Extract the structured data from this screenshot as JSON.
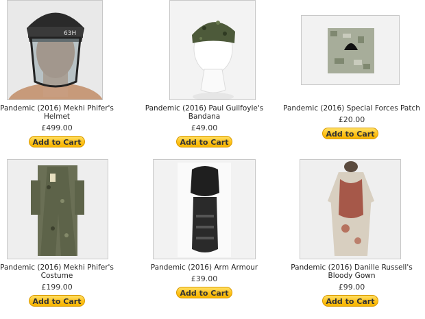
{
  "products": [
    {
      "title_line1": "Pandemic (2016) Mekhi Phifer's",
      "title_line2": "Helmet",
      "price": "£499.00",
      "button": "Add to Cart",
      "helmet_label": "63H"
    },
    {
      "title_line1": "Pandemic (2016) Paul Guilfoyle's",
      "title_line2": "Bandana",
      "price": "£49.00",
      "button": "Add to Cart"
    },
    {
      "title_line1": "Pandemic (2016) Special Forces Patch",
      "title_line2": "",
      "price": "£20.00",
      "button": "Add to Cart"
    },
    {
      "title_line1": "Pandemic (2016) Mekhi Phifer's",
      "title_line2": "Costume",
      "price": "£199.00",
      "button": "Add to Cart"
    },
    {
      "title_line1": "Pandemic (2016) Arm Armour",
      "title_line2": "",
      "price": "£39.00",
      "button": "Add to Cart"
    },
    {
      "title_line1": "Pandemic (2016) Danille Russell's",
      "title_line2": "Bloody Gown",
      "price": "£99.00",
      "button": "Add to Cart"
    }
  ]
}
